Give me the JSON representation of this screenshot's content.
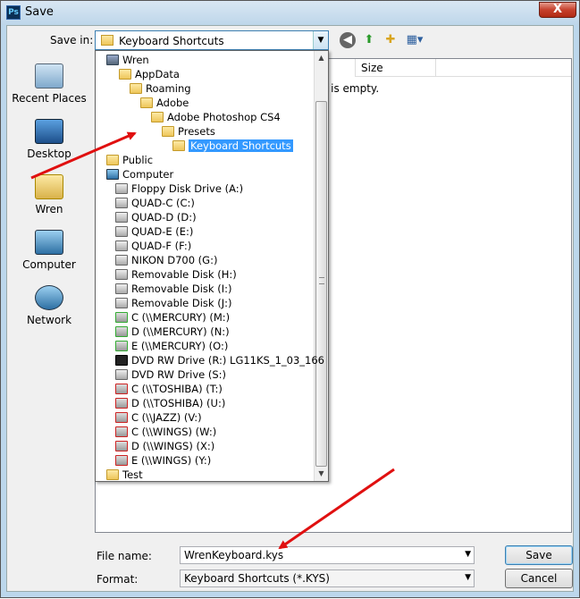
{
  "window": {
    "title": "Save",
    "icon": "Ps",
    "close": "X"
  },
  "save_in": {
    "label": "Save in:",
    "value": "Keyboard Shortcuts"
  },
  "toolbar": {
    "back": "back-icon",
    "up": "up-folder-icon",
    "new_folder": "new-folder-icon",
    "views": "views-menu-icon"
  },
  "places": [
    {
      "label": "Recent Places"
    },
    {
      "label": "Desktop"
    },
    {
      "label": "Wren"
    },
    {
      "label": "Computer"
    },
    {
      "label": "Network"
    }
  ],
  "file_list": {
    "column_size": "Size",
    "empty_message": "er is empty."
  },
  "dropdown_items": [
    {
      "label": "Wren",
      "icon": "user"
    },
    {
      "label": "AppData",
      "icon": "folder"
    },
    {
      "label": "Roaming",
      "icon": "folder"
    },
    {
      "label": "Adobe",
      "icon": "folder"
    },
    {
      "label": "Adobe Photoshop CS4",
      "icon": "folder"
    },
    {
      "label": "Presets",
      "icon": "folder"
    },
    {
      "label": "Keyboard Shortcuts",
      "icon": "folder",
      "selected": true
    },
    {
      "label": "Public",
      "icon": "folder"
    },
    {
      "label": "Computer",
      "icon": "computer"
    },
    {
      "label": "Floppy Disk Drive (A:)",
      "icon": "drive"
    },
    {
      "label": "QUAD-C (C:)",
      "icon": "drive"
    },
    {
      "label": "QUAD-D (D:)",
      "icon": "drive"
    },
    {
      "label": "QUAD-E (E:)",
      "icon": "drive"
    },
    {
      "label": "QUAD-F (F:)",
      "icon": "drive"
    },
    {
      "label": "NIKON D700 (G:)",
      "icon": "removable"
    },
    {
      "label": "Removable Disk (H:)",
      "icon": "removable"
    },
    {
      "label": "Removable Disk (I:)",
      "icon": "removable"
    },
    {
      "label": "Removable Disk (J:)",
      "icon": "removable"
    },
    {
      "label": "C (\\\\MERCURY) (M:)",
      "icon": "net-ok"
    },
    {
      "label": "D (\\\\MERCURY) (N:)",
      "icon": "net-ok"
    },
    {
      "label": "E (\\\\MERCURY) (O:)",
      "icon": "net-ok"
    },
    {
      "label": "DVD RW Drive (R:) LG11KS_1_03_166",
      "icon": "dvd"
    },
    {
      "label": "DVD RW Drive (S:)",
      "icon": "drive"
    },
    {
      "label": "C (\\\\TOSHIBA) (T:)",
      "icon": "net-bad"
    },
    {
      "label": "D (\\\\TOSHIBA) (U:)",
      "icon": "net-bad"
    },
    {
      "label": "C (\\\\JAZZ) (V:)",
      "icon": "net-bad"
    },
    {
      "label": "C (\\\\WINGS) (W:)",
      "icon": "net-bad"
    },
    {
      "label": "D (\\\\WINGS) (X:)",
      "icon": "net-bad"
    },
    {
      "label": "E (\\\\WINGS) (Y:)",
      "icon": "net-bad"
    },
    {
      "label": "Test",
      "icon": "folder"
    }
  ],
  "file_name": {
    "label": "File name:",
    "value": "WrenKeyboard.kys"
  },
  "format": {
    "label": "Format:",
    "value": "Keyboard Shortcuts (*.KYS)"
  },
  "buttons": {
    "save": "Save",
    "cancel": "Cancel"
  },
  "annotation_color": "#e01010"
}
